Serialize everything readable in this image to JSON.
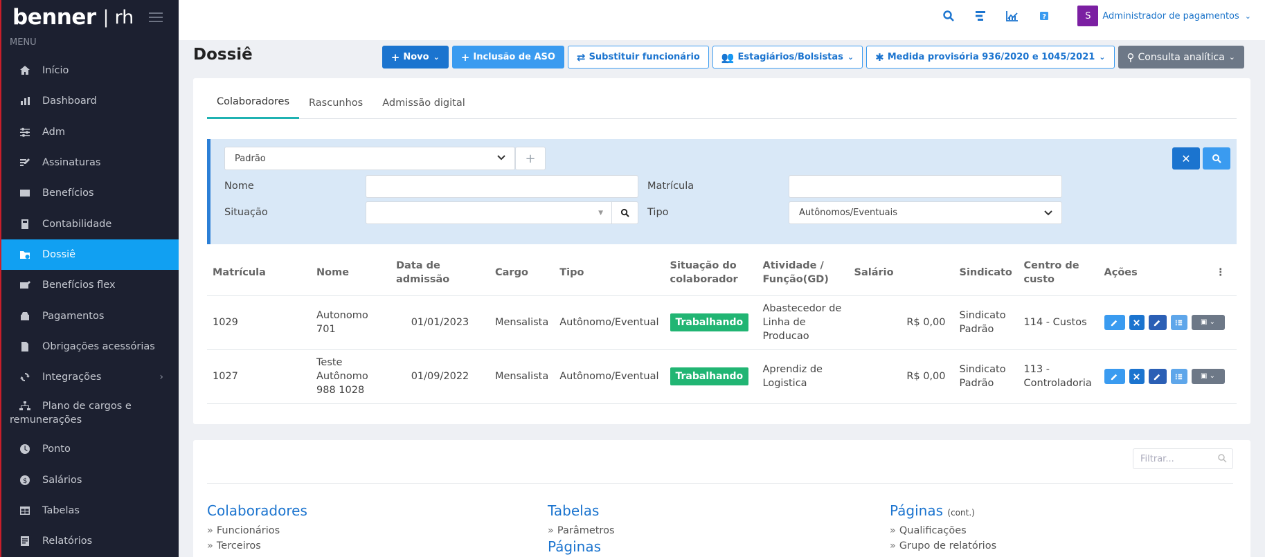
{
  "brand": {
    "logo": "benner",
    "separator": "|",
    "product": "rh"
  },
  "menu": {
    "title": "MENU",
    "items": [
      {
        "label": "Início",
        "icon": "home-icon"
      },
      {
        "label": "Dashboard",
        "icon": "bar-chart-icon"
      },
      {
        "label": "Adm",
        "icon": "sliders-icon"
      },
      {
        "label": "Assinaturas",
        "icon": "signature-icon"
      },
      {
        "label": "Benefícios",
        "icon": "card-icon"
      },
      {
        "label": "Contabilidade",
        "icon": "calculator-icon"
      },
      {
        "label": "Dossiê",
        "icon": "folder-user-icon",
        "active": true
      },
      {
        "label": "Benefícios flex",
        "icon": "card-flex-icon"
      },
      {
        "label": "Pagamentos",
        "icon": "payment-icon"
      },
      {
        "label": "Obrigações acessórias",
        "icon": "document-icon"
      },
      {
        "label": "Integrações",
        "icon": "sync-icon",
        "expandable": true
      },
      {
        "label": "Plano de cargos e",
        "label2": "remunerações",
        "icon": "org-chart-icon"
      },
      {
        "label": "Ponto",
        "icon": "clock-icon"
      },
      {
        "label": "Salários",
        "icon": "dollar-icon"
      },
      {
        "label": "Tabelas",
        "icon": "table-icon"
      },
      {
        "label": "Relatórios",
        "icon": "report-icon"
      }
    ]
  },
  "topbar": {
    "icons": [
      "search-icon",
      "tasks-icon",
      "chart-icon",
      "help-icon"
    ],
    "user": {
      "initial": "S",
      "name": "Administrador de pagamentos",
      "avatar_color": "#7b1fa2"
    }
  },
  "page": {
    "title": "Dossiê"
  },
  "actions": {
    "novo": "Novo",
    "inclusao_aso": "Inclusão de ASO",
    "substituir": "Substituir funcionário",
    "estagiarios": "Estagiários/Bolsistas",
    "medida": "Medida provisória 936/2020 e 1045/2021",
    "consulta": "Consulta analítica"
  },
  "tabs": [
    "Colaboradores",
    "Rascunhos",
    "Admissão digital"
  ],
  "filter": {
    "preset": "Padrão",
    "nome_label": "Nome",
    "nome_value": "",
    "matricula_label": "Matrícula",
    "matricula_value": "",
    "situacao_label": "Situação",
    "situacao_value": "",
    "tipo_label": "Tipo",
    "tipo_value": "Autônomos/Eventuais"
  },
  "table": {
    "headers": {
      "matricula": "Matrícula",
      "nome": "Nome",
      "admissao": "Data de admissão",
      "cargo": "Cargo",
      "tipo": "Tipo",
      "situacao_1": "Situação do",
      "situacao_2": "colaborador",
      "atividade_1": "Atividade /",
      "atividade_2": "Função(GD)",
      "salario": "Salário",
      "sindicato": "Sindicato",
      "centro_1": "Centro de",
      "centro_2": "custo",
      "acoes": "Ações"
    },
    "rows": [
      {
        "matricula": "1029",
        "nome_1": "Autonomo",
        "nome_2": "701",
        "nome_3": "",
        "admissao": "01/01/2023",
        "cargo": "Mensalista",
        "tipo": "Autônomo/Eventual",
        "situacao": "Trabalhando",
        "atividade_1": "Abastecedor de",
        "atividade_2": "Linha de",
        "atividade_3": "Producao",
        "salario": "R$ 0,00",
        "sindicato_1": "Sindicato",
        "sindicato_2": "Padrão",
        "centro_1": "114 - Custos",
        "centro_2": ""
      },
      {
        "matricula": "1027",
        "nome_1": "Teste",
        "nome_2": "Autônomo",
        "nome_3": "988 1028",
        "admissao": "01/09/2022",
        "cargo": "Mensalista",
        "tipo": "Autônomo/Eventual",
        "situacao": "Trabalhando",
        "atividade_1": "Aprendiz de",
        "atividade_2": "Logistica",
        "atividade_3": "",
        "salario": "R$ 0,00",
        "sindicato_1": "Sindicato",
        "sindicato_2": "Padrão",
        "centro_1": "113 -",
        "centro_2": "Controladoria"
      }
    ]
  },
  "links": {
    "filter_placeholder": "Filtrar...",
    "col1": {
      "title": "Colaboradores",
      "items": [
        "Funcionários",
        "Terceiros"
      ]
    },
    "col2": {
      "title": "Tabelas",
      "items": [
        "Parâmetros"
      ],
      "next": "Páginas"
    },
    "col3": {
      "title": "Páginas",
      "suffix": "(cont.)",
      "items": [
        "Qualificações",
        "Grupo de relatórios"
      ]
    }
  },
  "colors": {
    "accent": "#11a0f2",
    "primary": "#1b74cf",
    "sidebar": "#1c2030",
    "success": "#21b573",
    "filter_bg": "#d9e8f7"
  }
}
